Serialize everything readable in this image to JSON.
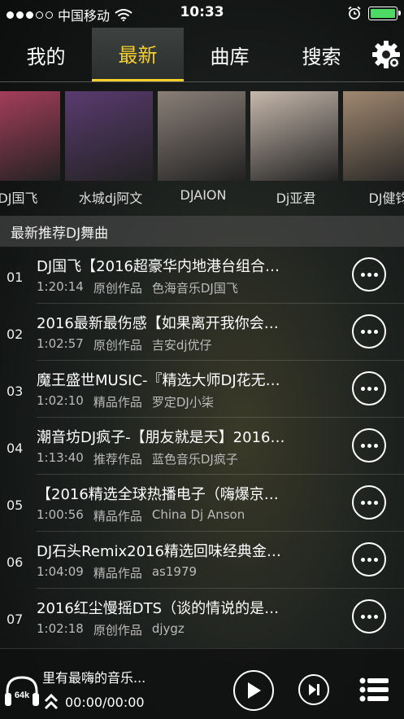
{
  "status_bar": {
    "carrier": "中国移动",
    "time": "10:33",
    "signal_bars_filled": 3,
    "signal_bars_total": 5,
    "battery_level": 1.0
  },
  "tabs": [
    {
      "label": "我的",
      "active": false
    },
    {
      "label": "最新",
      "active": true
    },
    {
      "label": "曲库",
      "active": false
    },
    {
      "label": "搜索",
      "active": false
    }
  ],
  "artists": [
    {
      "name": "DJ国飞",
      "color": "#b04060"
    },
    {
      "name": "水城dj阿文",
      "color": "#5a3b70"
    },
    {
      "name": "DJAION",
      "color": "#8a7f78"
    },
    {
      "name": "Dj亚君",
      "color": "#c6b8ac"
    },
    {
      "name": "DJ健钧",
      "color": "#a08870"
    }
  ],
  "section": {
    "title": "最新推荐DJ舞曲"
  },
  "songs": [
    {
      "num": "01",
      "title": "DJ国飞【2016超豪华内地港台组合…",
      "duration": "1:20:14",
      "category": "原创作品",
      "author": "色海音乐DJ国飞"
    },
    {
      "num": "02",
      "title": "2016最新最伤感【如果离开我你会…",
      "duration": "1:02:57",
      "category": "原创作品",
      "author": "吉安dj优仔"
    },
    {
      "num": "03",
      "title": "魔王盛世MUSIC-『精选大师DJ花无…",
      "duration": "1:02:10",
      "category": "精品作品",
      "author": "罗定DJ小柒"
    },
    {
      "num": "04",
      "title": "潮音坊DJ疯子-【朋友就是天】2016…",
      "duration": "1:13:40",
      "category": "推荐作品",
      "author": "蓝色音乐DJ疯子"
    },
    {
      "num": "05",
      "title": "【2016精选全球热播电子（嗨爆京…",
      "duration": "1:00:56",
      "category": "精品作品",
      "author": "China Dj Anson"
    },
    {
      "num": "06",
      "title": "DJ石头Remix2016精选回味经典金…",
      "duration": "1:04:09",
      "category": "精品作品",
      "author": "as1979"
    },
    {
      "num": "07",
      "title": "2016红尘慢摇DTS（谈的情说的是…",
      "duration": "1:02:18",
      "category": "原创作品",
      "author": "djygz"
    }
  ],
  "player": {
    "now_playing": "里有最嗨的音乐...",
    "time": "00:00/00:00",
    "bitrate": "64k"
  },
  "colors": {
    "accent": "#f5cf2b",
    "battery": "#4cd964"
  }
}
